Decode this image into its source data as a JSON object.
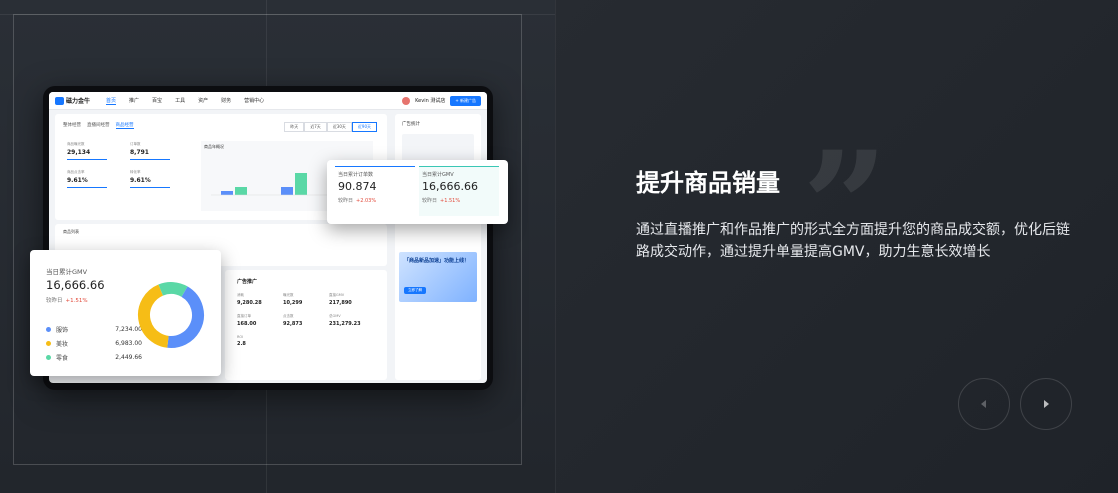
{
  "dashboard": {
    "logo": "磁力金牛",
    "nav": [
      "首页",
      "推广",
      "百宝",
      "工具",
      "资产",
      "财务",
      "营销中心"
    ],
    "user": "Kevin 测试店",
    "new_button": "+ 新建广告",
    "tabs": [
      "整体经营",
      "直播间经营",
      "商品经营"
    ],
    "ranges": [
      "昨天",
      "近7天",
      "近30天",
      "近90天"
    ],
    "kpis": [
      {
        "label": "商品曝光数",
        "value": "29,134"
      },
      {
        "label": "订单数",
        "value": "8,791"
      },
      {
        "label": "商品点击率",
        "value": "9.61%"
      },
      {
        "label": "转化率",
        "value": "9.61%"
      }
    ],
    "chart_title": "商品年概况",
    "ad_card": {
      "title": "广告推广",
      "items": [
        {
          "label": "消耗",
          "value": "9,280.28"
        },
        {
          "label": "曝光数",
          "value": "10,299"
        },
        {
          "label": "直接GMV",
          "value": "217,890"
        },
        {
          "label": "直接订单",
          "value": "168.00"
        },
        {
          "label": "点击数",
          "value": "92,873"
        },
        {
          "label": "总GMV",
          "value": "231,279.23"
        },
        {
          "label": "ROI",
          "value": "2.8"
        }
      ]
    },
    "side_title": "广告统计",
    "banner_text": "「商品新品加速」功能上线！",
    "banner_button": "立即了解",
    "list_title": "商品列表"
  },
  "orders_card": {
    "left": {
      "label": "当日累计订单数",
      "value": "90.874",
      "compare_label": "较昨日",
      "change": "+2.03%"
    },
    "right": {
      "label": "当日累计GMV",
      "value": "16,666.66",
      "compare_label": "较昨日",
      "change": "+1.51%"
    }
  },
  "gmv_card": {
    "label": "当日累计GMV",
    "value": "16,666.66",
    "compare_label": "较昨日",
    "change": "+1.51%",
    "legend": [
      {
        "name": "服饰",
        "value": "7,234.00",
        "color": "#5b8ff9"
      },
      {
        "name": "美妆",
        "value": "6,983.00",
        "color": "#f6bd16"
      },
      {
        "name": "零食",
        "value": "2,449.66",
        "color": "#5ad8a6"
      }
    ]
  },
  "chart_data": {
    "type": "pie",
    "categories": [
      "服饰",
      "美妆",
      "零食"
    ],
    "values": [
      7234.0,
      6983.0,
      2449.66
    ],
    "colors": [
      "#5b8ff9",
      "#f6bd16",
      "#5ad8a6"
    ]
  },
  "content": {
    "title": "提升商品销量",
    "description": "通过直播推广和作品推广的形式全方面提升您的商品成交额，优化后链路成交动作，通过提升单量提高GMV，助力生意长效增长"
  },
  "icons": {
    "prev": "arrow-left-icon",
    "next": "arrow-right-icon",
    "quote": "quote-icon"
  }
}
